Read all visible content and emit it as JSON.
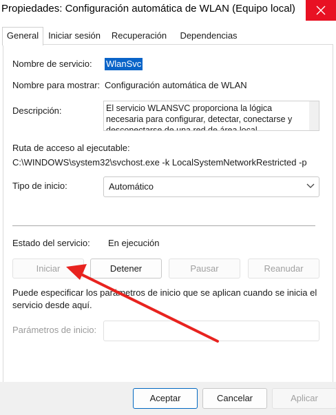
{
  "window": {
    "title": "Propiedades: Configuración automática de WLAN (Equipo local)",
    "close_icon": "close-icon"
  },
  "tabs": [
    {
      "label": "General",
      "active": true
    },
    {
      "label": "Iniciar sesión",
      "active": false
    },
    {
      "label": "Recuperación",
      "active": false
    },
    {
      "label": "Dependencias",
      "active": false
    }
  ],
  "general": {
    "service_name_label": "Nombre de servicio:",
    "service_name_value": "WlanSvc",
    "display_name_label": "Nombre para mostrar:",
    "display_name_value": "Configuración automática de WLAN",
    "description_label": "Descripción:",
    "description_value": "El servicio WLANSVC proporciona la lógica necesaria para configurar, detectar, conectarse y desconectarse de una red de área local",
    "path_label": "Ruta de acceso al ejecutable:",
    "path_value": "C:\\WINDOWS\\system32\\svchost.exe -k LocalSystemNetworkRestricted -p",
    "startup_type_label": "Tipo de inicio:",
    "startup_type_value": "Automático",
    "status_label": "Estado del servicio:",
    "status_value": "En ejecución",
    "buttons": {
      "start": "Iniciar",
      "stop": "Detener",
      "pause": "Pausar",
      "resume": "Reanudar"
    },
    "hint": "Puede especificar los parámetros de inicio que se aplican cuando se inicia el servicio desde aquí.",
    "params_label": "Parámetros de inicio:",
    "params_value": ""
  },
  "footer": {
    "accept": "Aceptar",
    "cancel": "Cancelar",
    "apply": "Aplicar"
  },
  "colors": {
    "close_button": "#e81123",
    "selection": "#0a64c8",
    "annotation_arrow": "#e8231f",
    "primary_border": "#0067c0"
  }
}
